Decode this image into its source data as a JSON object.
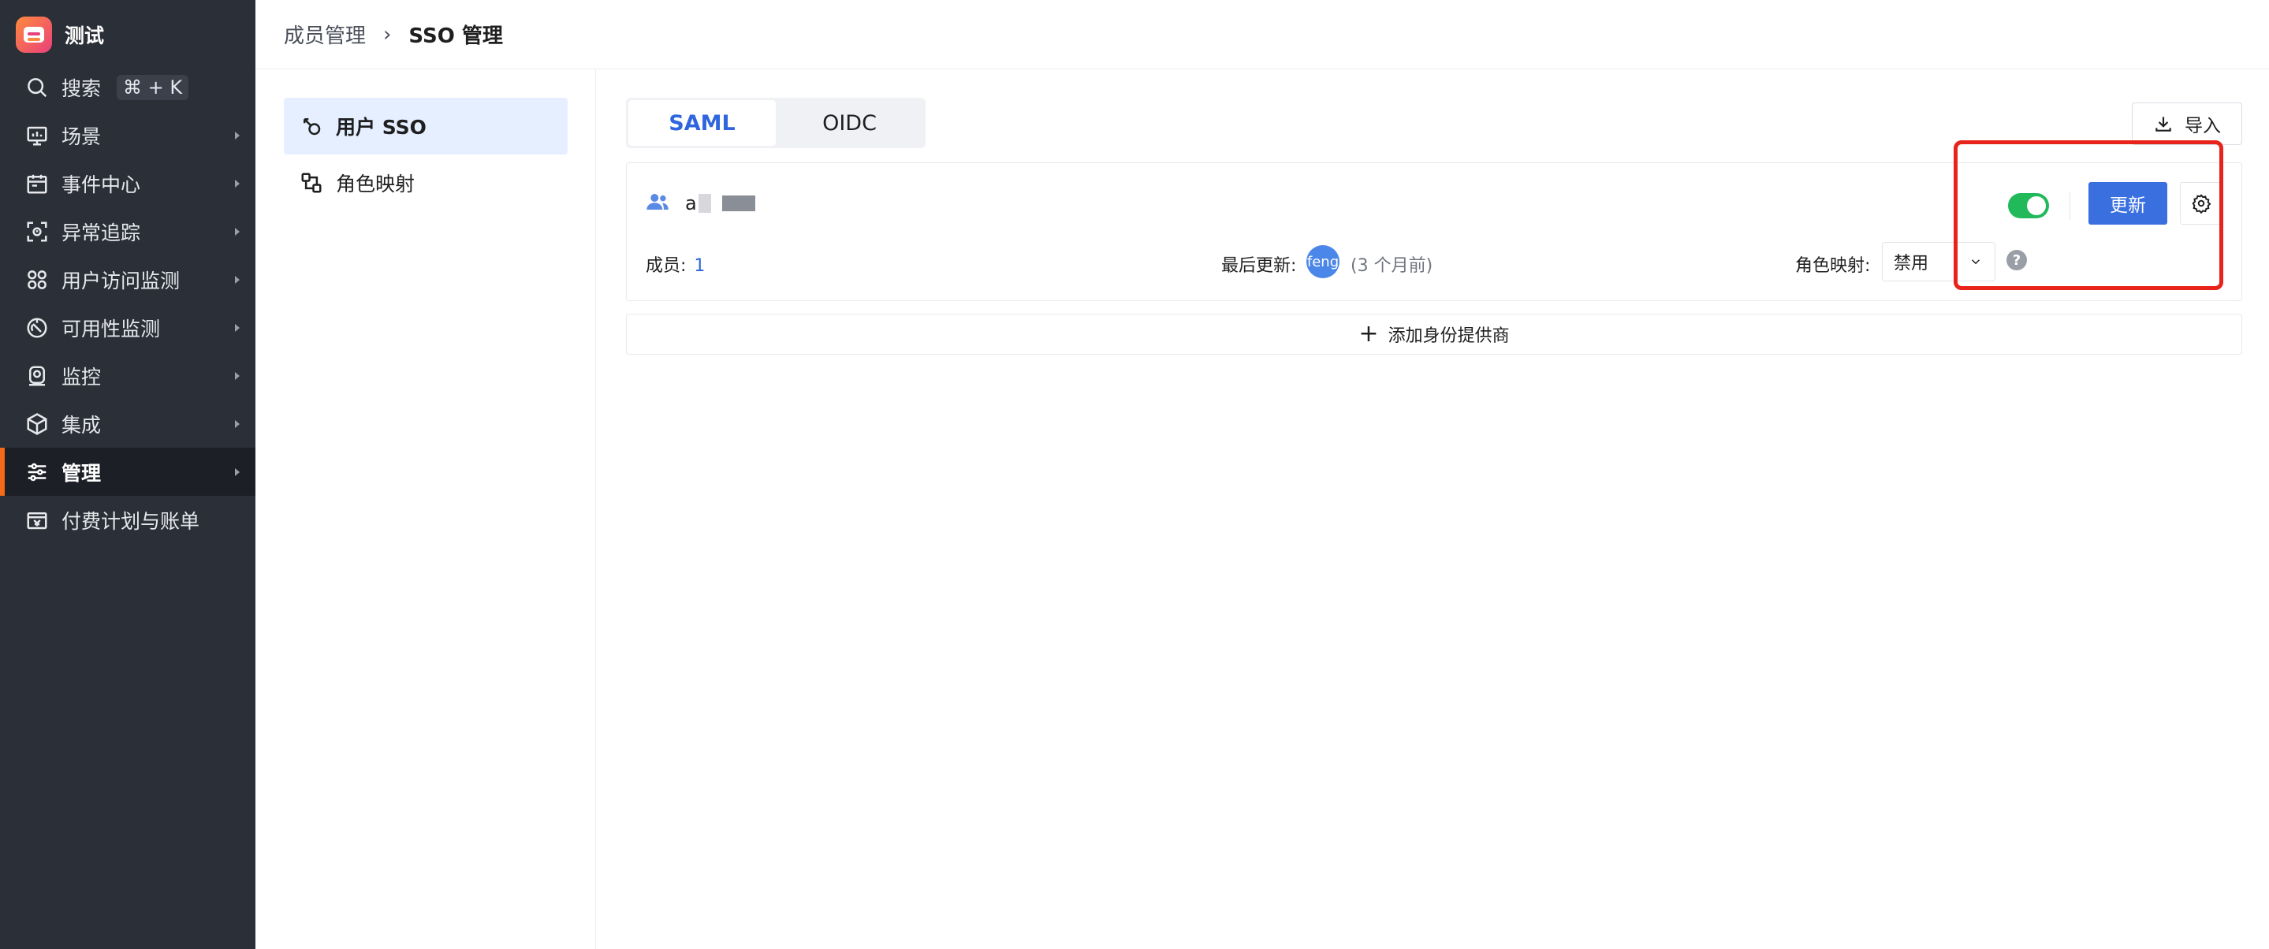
{
  "app": {
    "name": "测试"
  },
  "sidebar": {
    "search": {
      "label": "搜索",
      "shortcut": "⌘ + K"
    },
    "items": [
      {
        "label": "场景",
        "icon": "monitor-icon"
      },
      {
        "label": "事件中心",
        "icon": "calendar-icon"
      },
      {
        "label": "异常追踪",
        "icon": "scan-icon"
      },
      {
        "label": "用户访问监测",
        "icon": "grid-icon"
      },
      {
        "label": "可用性监测",
        "icon": "dial-icon"
      },
      {
        "label": "监控",
        "icon": "camera-icon"
      },
      {
        "label": "集成",
        "icon": "cube-icon"
      },
      {
        "label": "管理",
        "icon": "sliders-icon",
        "active": true
      },
      {
        "label": "付费计划与账单",
        "icon": "bill-icon"
      }
    ]
  },
  "breadcrumb": {
    "parent": "成员管理",
    "separator": "›",
    "current": "SSO 管理"
  },
  "submenu": {
    "items": [
      {
        "label": "用户 SSO",
        "icon": "sso-icon",
        "active": true
      },
      {
        "label": "角色映射",
        "icon": "mapping-icon"
      }
    ]
  },
  "tabs": [
    {
      "label": "SAML",
      "active": true
    },
    {
      "label": "OIDC"
    }
  ],
  "import_button": {
    "label": "导入"
  },
  "provider": {
    "name": "a",
    "enabled": true,
    "members_label": "成员:",
    "members_count": "1",
    "last_updated_label": "最后更新:",
    "updater_avatar": "feng",
    "updated_ago": "(3 个月前)",
    "role_mapping_label": "角色映射:",
    "role_mapping_value": "禁用",
    "update_button": "更新",
    "help_symbol": "?"
  },
  "add_provider": {
    "label": "添加身份提供商",
    "symbol": "+"
  },
  "colors": {
    "accent": "#2f66de",
    "sidebar_bg": "#2b2f38",
    "active_marker": "#f46a16",
    "toggle_on": "#22b95a",
    "highlight": "#e8231b"
  }
}
